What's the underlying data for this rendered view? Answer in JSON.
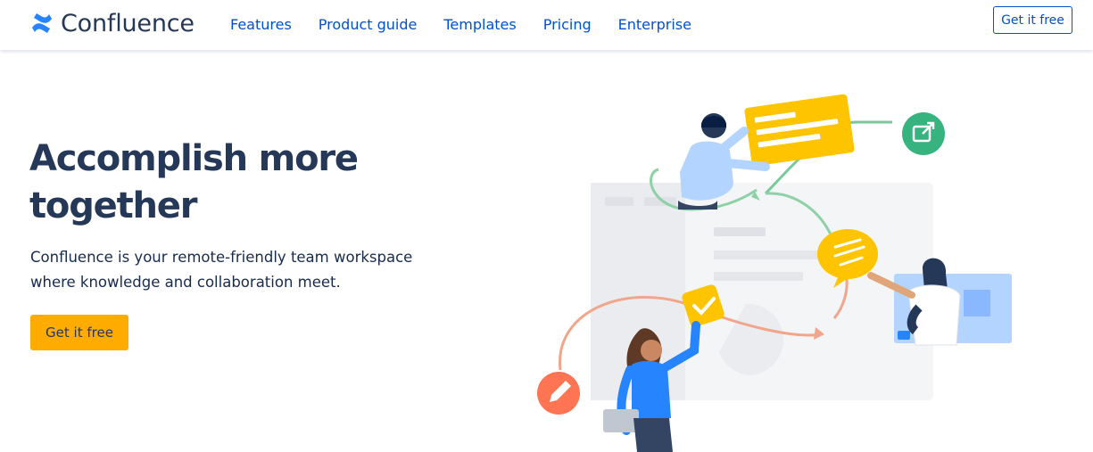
{
  "brand": {
    "name": "Confluence",
    "logo_icon": "confluence-logo-icon",
    "color": "#2684ff"
  },
  "nav": {
    "links": [
      "Features",
      "Product guide",
      "Templates",
      "Pricing",
      "Enterprise"
    ],
    "cta_label": "Get it free"
  },
  "hero": {
    "title": "Accomplish more together",
    "subtitle": "Confluence is your remote-friendly team workspace where knowledge and collaboration meet.",
    "cta_label": "Get it free"
  },
  "illustration": {
    "icons": [
      "share-icon",
      "pencil-icon",
      "checkmark-icon",
      "chat-bubble-icon",
      "video-camera-icon"
    ],
    "colors": {
      "yellow": "#ffc400",
      "green": "#36b37e",
      "coral": "#ff7452",
      "blue": "#2684ff",
      "light_blue": "#b3d4ff",
      "navy": "#253858"
    }
  },
  "colors": {
    "primary_link": "#0052cc",
    "cta": "#ffab00",
    "heading": "#253858"
  }
}
